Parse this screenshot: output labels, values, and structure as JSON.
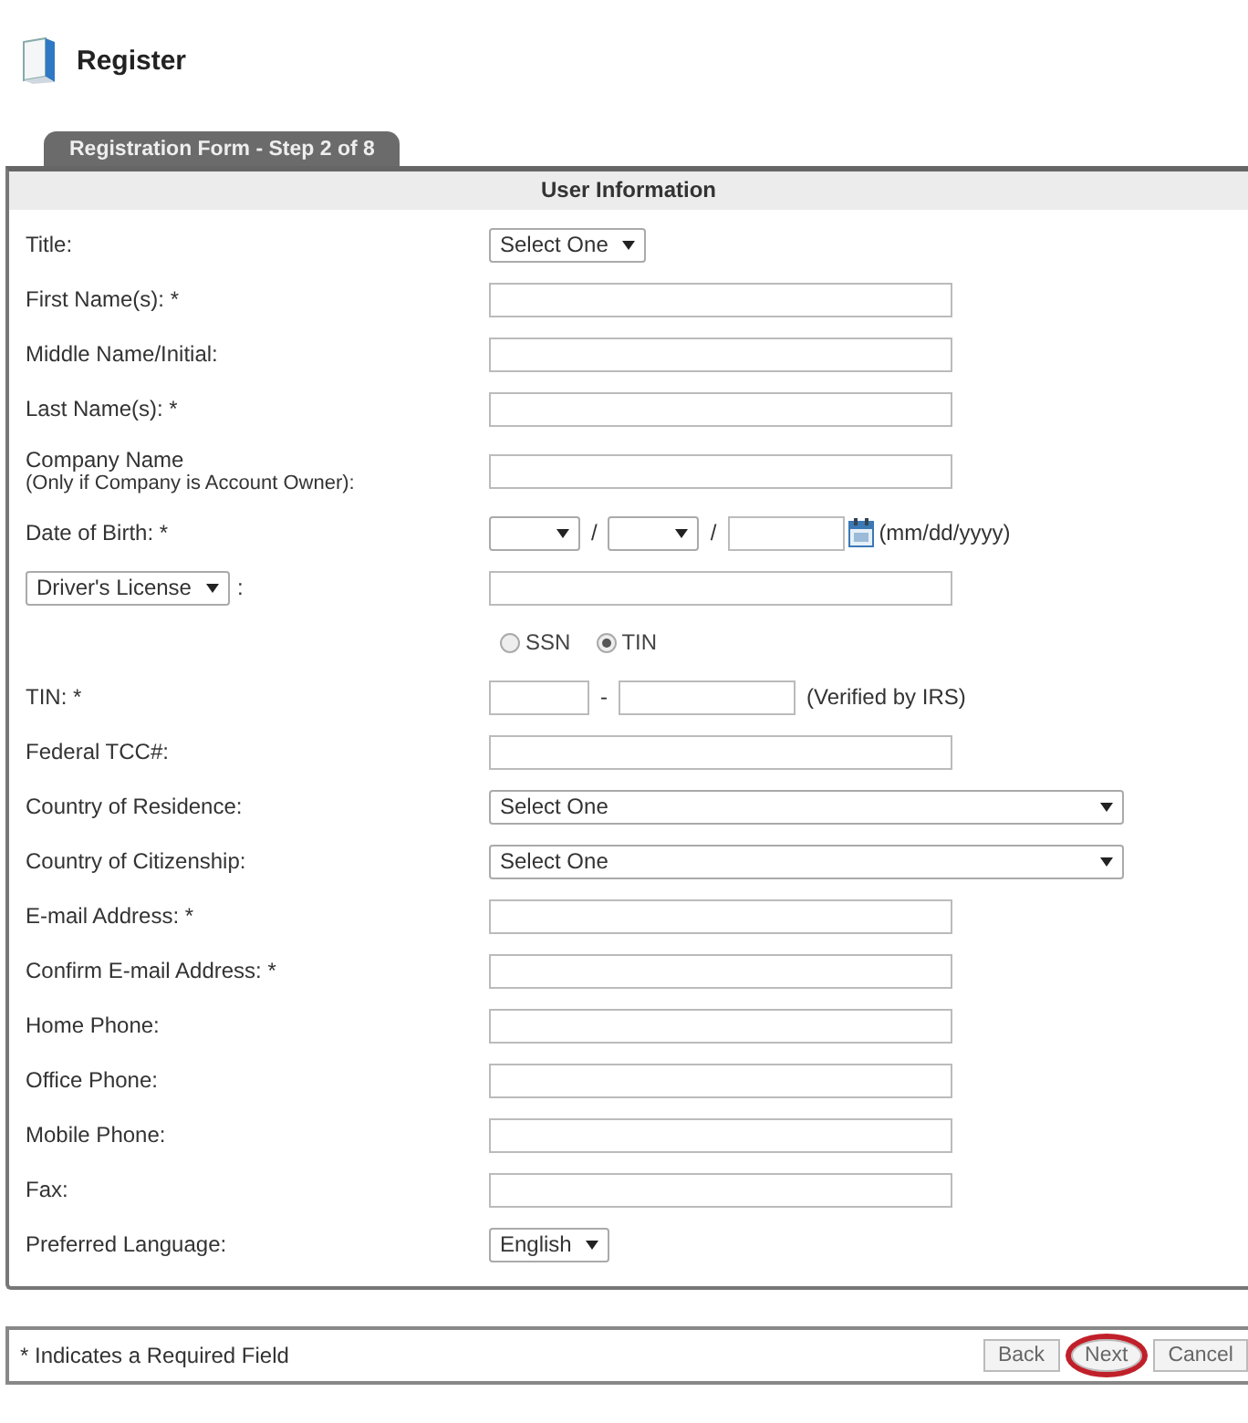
{
  "header": {
    "title": "Register"
  },
  "tab": {
    "label": "Registration Form - Step 2 of 8"
  },
  "section": {
    "title": "User Information"
  },
  "rows": [
    {
      "kind": "select",
      "label": "Title:",
      "value": "Select One"
    },
    {
      "kind": "text",
      "label": "First Name(s): *"
    },
    {
      "kind": "text",
      "label": "Middle Name/Initial:"
    },
    {
      "kind": "text",
      "label": "Last Name(s): *"
    },
    {
      "kind": "text",
      "label": "Company Name",
      "sublabel": "(Only if Company is Account Owner):"
    },
    {
      "kind": "date",
      "label": "Date of Birth: *",
      "separators": [
        "/",
        "/"
      ],
      "hint": "(mm/dd/yyyy)"
    },
    {
      "kind": "idtype",
      "value": "Driver's License",
      "colon": ":"
    },
    {
      "kind": "radio",
      "options": [
        {
          "label": "SSN",
          "selected": false
        },
        {
          "label": "TIN",
          "selected": true
        }
      ]
    },
    {
      "kind": "tin",
      "label": "TIN: *",
      "dash": "-",
      "hint": "(Verified by IRS)"
    },
    {
      "kind": "text",
      "label": "Federal TCC#:"
    },
    {
      "kind": "wide",
      "label": "Country of Residence:",
      "value": "Select One"
    },
    {
      "kind": "wide",
      "label": "Country of Citizenship:",
      "value": "Select One"
    },
    {
      "kind": "text",
      "label": "E-mail Address: *"
    },
    {
      "kind": "text",
      "label": "Confirm E-mail Address: *"
    },
    {
      "kind": "text",
      "label": "Home Phone:"
    },
    {
      "kind": "text",
      "label": "Office Phone:"
    },
    {
      "kind": "text",
      "label": "Mobile Phone:"
    },
    {
      "kind": "text",
      "label": "Fax:"
    },
    {
      "kind": "select",
      "label": "Preferred Language:",
      "value": "English"
    }
  ],
  "footer": {
    "note": "* Indicates a Required Field",
    "buttons": [
      {
        "label": "Back",
        "circled": false
      },
      {
        "label": "Next",
        "circled": true
      },
      {
        "label": "Cancel",
        "circled": false
      }
    ]
  }
}
